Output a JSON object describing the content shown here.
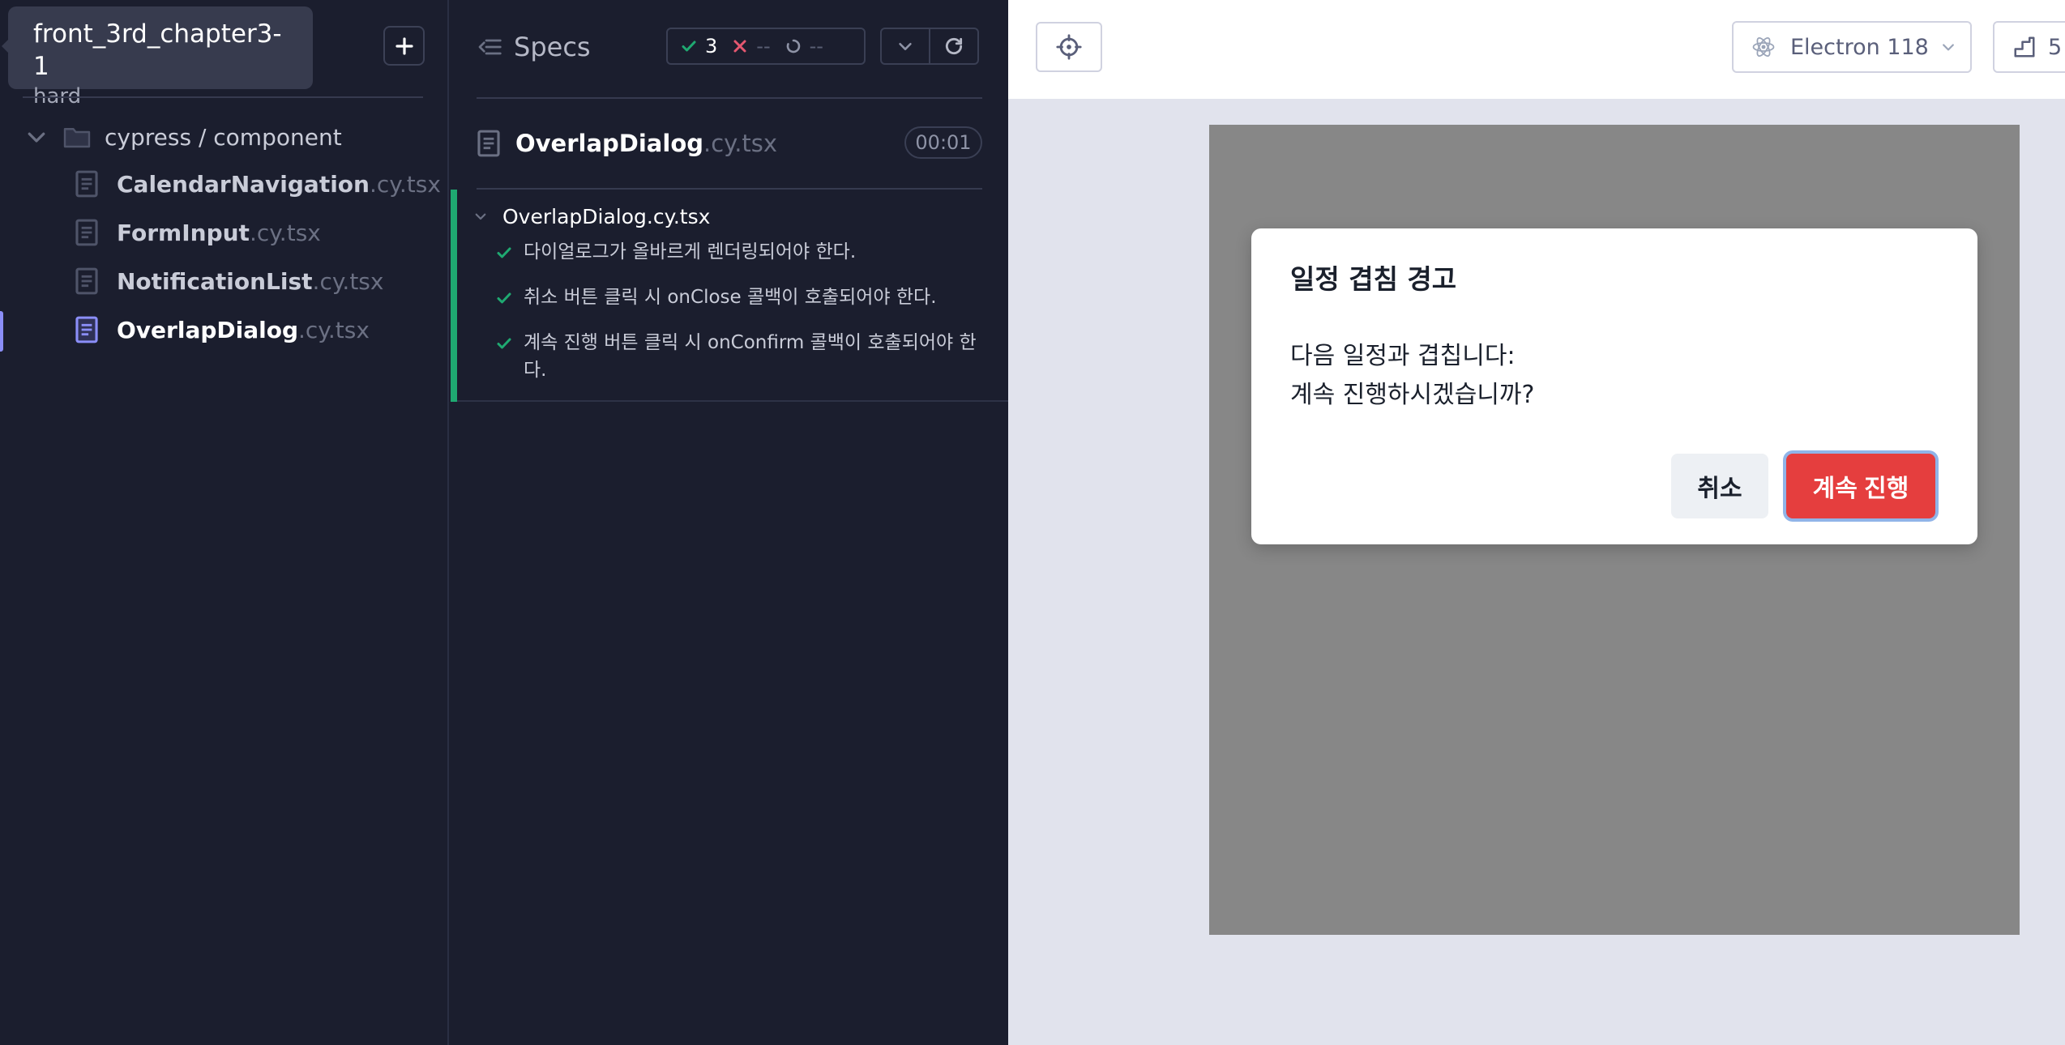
{
  "project": {
    "name": "front_3rd_chapter3-1",
    "branch": "hard"
  },
  "sidebar": {
    "directory": "cypress / component",
    "files": [
      {
        "base": "CalendarNavigation",
        "ext": ".cy.tsx"
      },
      {
        "base": "FormInput",
        "ext": ".cy.tsx"
      },
      {
        "base": "NotificationList",
        "ext": ".cy.tsx"
      },
      {
        "base": "OverlapDialog",
        "ext": ".cy.tsx"
      }
    ]
  },
  "reporter": {
    "title": "Specs",
    "stats": {
      "passed": "3",
      "failed": "--",
      "pending": "--"
    },
    "running_file": {
      "base": "OverlapDialog",
      "ext": ".cy.tsx"
    },
    "duration": "00:01",
    "suite": {
      "title": "OverlapDialog.cy.tsx",
      "tests": [
        "다이얼로그가 올바르게 렌더링되어야 한다.",
        "취소 버튼 클릭 시 onClose 콜백이 호출되어야 한다.",
        "계속 진행 버튼 클릭 시 onConfirm 콜백이 호출되어야 한다."
      ]
    }
  },
  "aut": {
    "browser": "Electron 118",
    "viewport": "5",
    "dialog": {
      "title": "일정 겹침 경고",
      "line1": "다음 일정과 겹칩니다:",
      "line2": "계속 진행하시겠습니까?",
      "cancel": "취소",
      "confirm": "계속 진행"
    }
  },
  "colors": {
    "pass": "#1fa971",
    "fail": "#e45770",
    "accent": "#8b8ef8",
    "confirm": "#e53e3e"
  },
  "icons": [
    "chevron-down-icon",
    "folder-icon",
    "document-icon",
    "specs-icon",
    "check-icon",
    "x-icon",
    "pending-icon",
    "refresh-icon",
    "crosshair-icon",
    "electron-icon",
    "ruler-icon",
    "plus-icon"
  ]
}
